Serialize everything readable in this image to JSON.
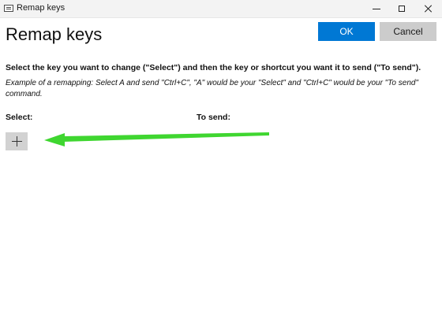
{
  "window": {
    "title": "Remap keys",
    "icon": "keyboard-icon"
  },
  "header": {
    "title": "Remap keys",
    "ok_label": "OK",
    "cancel_label": "Cancel"
  },
  "instructions": {
    "main": "Select the key you want to change (\"Select\") and then the key or shortcut you want it to send (\"To send\").",
    "example": "Example of a remapping: Select A and send \"Ctrl+C\", \"A\" would be your \"Select\" and \"Ctrl+C\" would be your \"To send\" command."
  },
  "columns": {
    "select_label": "Select:",
    "to_send_label": "To send:"
  },
  "add_button": {
    "icon": "plus-icon"
  },
  "colors": {
    "accent": "#0078d4",
    "cancel_bg": "#cccccc",
    "add_bg": "#d2d2d2",
    "annotation_arrow": "#3fd630"
  }
}
